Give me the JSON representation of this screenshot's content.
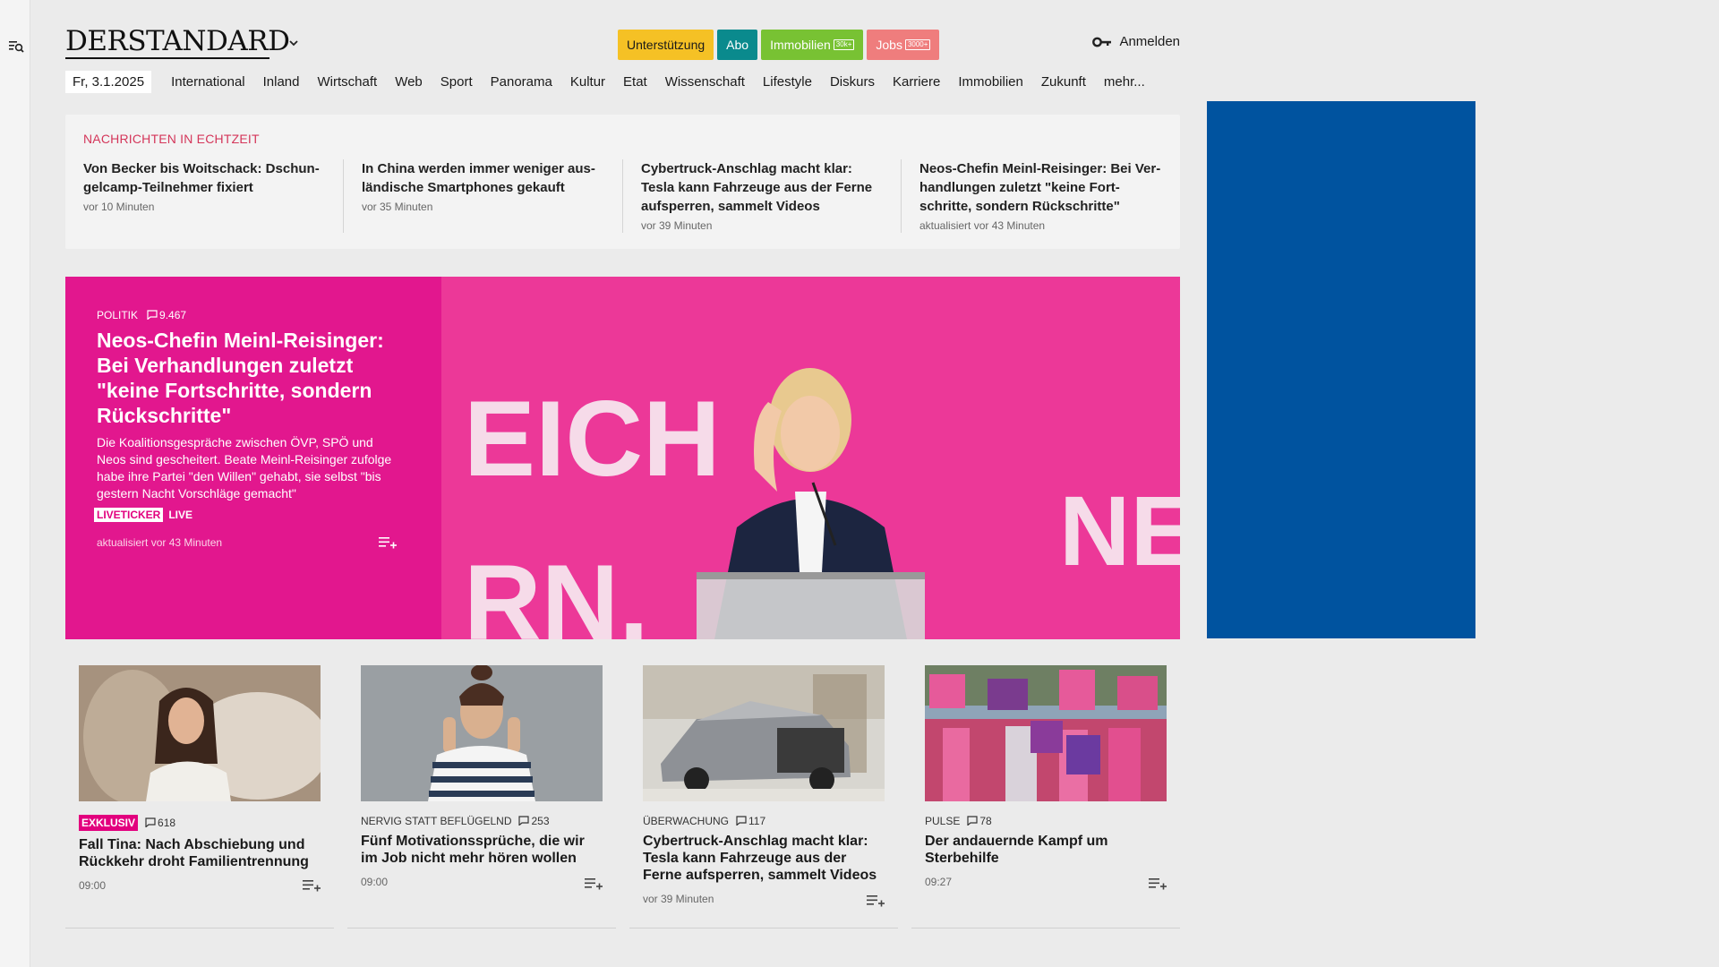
{
  "header": {
    "logo": "DERSTANDARD",
    "pills": [
      {
        "label": "Unterstützung",
        "badge": "",
        "bg": "#f5c125",
        "fg": "#1a1a1a"
      },
      {
        "label": "Abo",
        "badge": "",
        "bg": "#0a8a8d",
        "fg": "#ffffff"
      },
      {
        "label": "Immobilien",
        "badge": "30k+",
        "bg": "#78c233",
        "fg": "#ffffff"
      },
      {
        "label": "Jobs",
        "badge": "3000+",
        "bg": "#ef7d7d",
        "fg": "#ffffff"
      }
    ],
    "login_label": "Anmelden"
  },
  "nav": {
    "date": "Fr, 3.1.2025",
    "items": [
      "International",
      "Inland",
      "Wirtschaft",
      "Web",
      "Sport",
      "Panorama",
      "Kultur",
      "Etat",
      "Wissenschaft",
      "Lifestyle",
      "Diskurs",
      "Karriere",
      "Immobilien",
      "Zukunft",
      "mehr..."
    ]
  },
  "ticker": {
    "title": "NACHRICHTEN IN ECHTZEIT",
    "items": [
      {
        "title": "Von Becker bis Woitschack: Dschun­gelcamp-Teilnehmer fixiert",
        "time": "vor 10 Minuten"
      },
      {
        "title": "In China werden immer weniger aus­ländische Smartphones gekauft",
        "time": "vor 35 Minuten"
      },
      {
        "title": "Cybertruck-Anschlag macht klar: Tesla kann Fahrzeuge aus der Ferne aufsperren, sammelt Videos",
        "time": "vor 39 Minuten"
      },
      {
        "title": "Neos-Chefin Meinl-Reisinger: Bei Ver­handlungen zuletzt \"keine Fort­schritte, sondern Rückschritte\"",
        "time": "aktualisiert vor 43 Minuten"
      }
    ]
  },
  "hero": {
    "section": "POLITIK",
    "posts": "9.467",
    "title": "Neos-Chefin Meinl-Reisinger: Bei Verhandlungen zuletzt \"keine Fortschritte, sondern Rückschritte\"",
    "lead": "Die Koalitionsgespräche zwischen ÖVP, SPÖ und Neos sind gescheitert. Beate Meinl-Reisinger zufolge habe ihre Partei \"den Willen\" gehabt, sie selbst \"bis gestern Nacht Vorschläge gemacht\"",
    "liveticker": "LIVETICKER",
    "live": "LIVE",
    "time": "aktualisiert vor 43 Minuten",
    "backdrop_text_1": "EICH",
    "backdrop_text_2": "RN.",
    "backdrop_text_3": "NE"
  },
  "cards": [
    {
      "kicker": "EXKLUSIV",
      "kicker_style": "highlight",
      "posts": "618",
      "title": "Fall Tina: Nach Abschiebung und Rückkehr droht Familientrennung",
      "time": "09:00"
    },
    {
      "kicker": "NERVIG STATT BEFLÜGELND",
      "kicker_style": "plain",
      "posts": "253",
      "title": "Fünf Motivationssprüche, die wir im Job nicht mehr hören wollen",
      "time": "09:00"
    },
    {
      "kicker": "ÜBERWACHUNG",
      "kicker_style": "plain",
      "posts": "117",
      "title": "Cybertruck-Anschlag macht klar: Tesla kann Fahrzeuge aus der Ferne aufsperren, sammelt Videos",
      "time": "vor 39 Minuten"
    },
    {
      "kicker": "PULSE",
      "kicker_style": "plain",
      "posts": "78",
      "title": "Der andauernde Kampf um Sterbehilfe",
      "time": "09:27"
    }
  ],
  "colors": {
    "accent_red": "#d4365a",
    "hero_magenta": "#e2007e",
    "ad_blue": "#00539f"
  },
  "icons": {
    "rail": "search-menu-icon",
    "login": "key-icon",
    "posts": "speech-bubble-icon",
    "add": "add-to-list-icon",
    "toggle": "chevron-down-icon"
  }
}
